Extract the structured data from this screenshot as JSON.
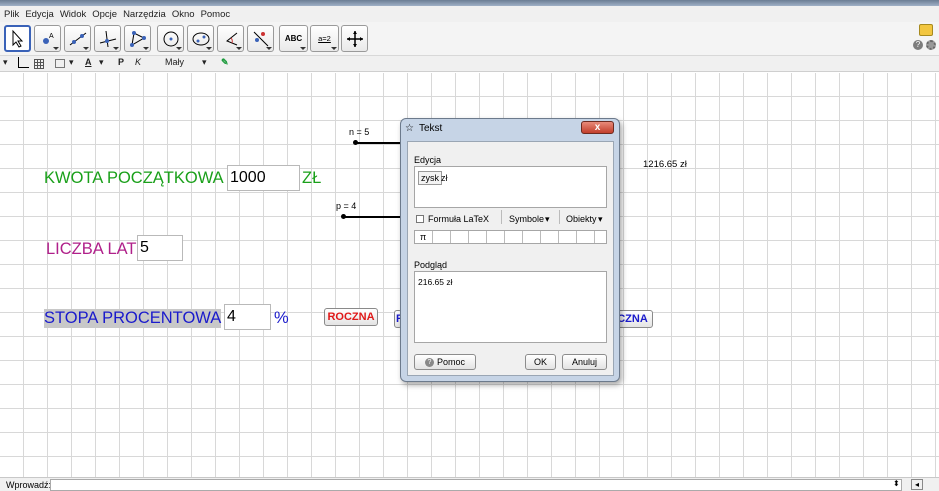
{
  "menu": [
    "Plik",
    "Edycja",
    "Widok",
    "Opcje",
    "Narzędzia",
    "Okno",
    "Pomoc"
  ],
  "toolbar": {
    "tools": [
      "move-tool",
      "point-tool",
      "line-tool",
      "perpendicular-tool",
      "polygon-tool",
      "circle-tool",
      "conic-tool",
      "angle-tool",
      "reflect-tool",
      "text-tool",
      "slider-tool",
      "move-graphics-tool"
    ],
    "text_tool_label": "ABC",
    "slider_tool_label": "a=2"
  },
  "stylebar": {
    "bold": "P",
    "italic": "K",
    "font_size": "Mały"
  },
  "canvas": {
    "kwota_label": "KWOTA POCZĄTKOWA",
    "kwota_value": "1000",
    "kwota_unit": "ZŁ",
    "lat_label": "LICZBA LAT",
    "lat_value": "5",
    "stopa_label": "STOPA PROCENTOWA",
    "stopa_value": "4",
    "stopa_unit": "%",
    "slider_n": "n = 5",
    "slider_p": "p = 4",
    "result": "1216.65 zł",
    "btn_roczna": "ROCZNA",
    "btn_partial_left": "R",
    "btn_partial_right": "CZNA"
  },
  "dialog": {
    "title": "Tekst",
    "close": "x",
    "edit_label": "Edycja",
    "edit_object": "zysk",
    "edit_text": " zł",
    "latex_label": "Formuła LaTeX",
    "symbols_label": "Symbole",
    "objects_label": "Obiekty",
    "pi_symbol": "π",
    "preview_label": "Podgląd",
    "preview_text": "216.65 zł",
    "help_label": "Pomoc",
    "ok_label": "OK",
    "cancel_label": "Anuluj"
  },
  "input_bar": {
    "label": "Wprowadź:"
  },
  "colors": {
    "green": "#1aa01a",
    "magenta": "#b0208a",
    "blue": "#1a1acc",
    "red": "#e01818"
  }
}
